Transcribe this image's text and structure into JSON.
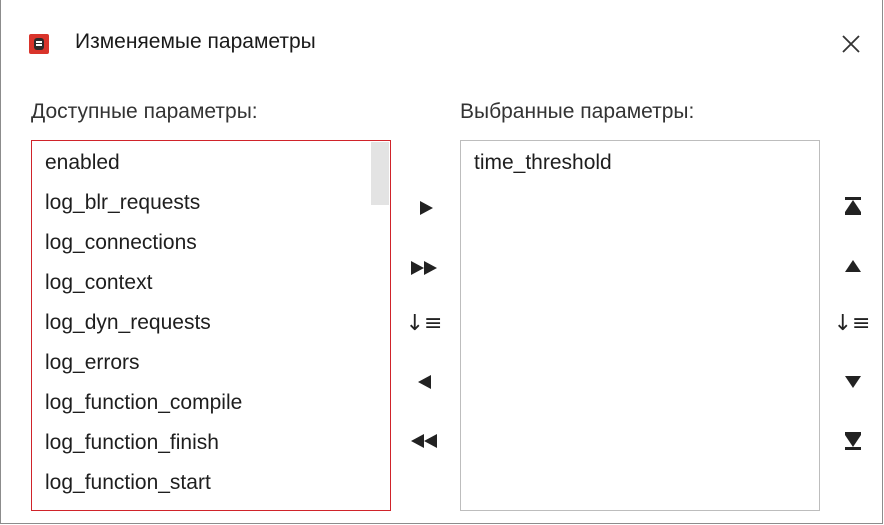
{
  "window": {
    "title": "Изменяемые параметры",
    "close_icon": "close-icon",
    "app_icon": "database-icon"
  },
  "available": {
    "label": "Доступные параметры:",
    "items": [
      "enabled",
      "log_blr_requests",
      "log_connections",
      "log_context",
      "log_dyn_requests",
      "log_errors",
      "log_function_compile",
      "log_function_finish",
      "log_function_start"
    ]
  },
  "selected": {
    "label": "Выбранные параметры:",
    "items": [
      "time_threshold"
    ]
  },
  "transfer_buttons": {
    "icons": [
      "move-right-icon",
      "move-all-right-icon",
      "sort-icon",
      "move-left-icon",
      "move-all-left-icon"
    ]
  },
  "order_buttons": {
    "icons": [
      "move-to-top-icon",
      "move-up-icon",
      "sort-icon",
      "move-down-icon",
      "move-to-bottom-icon"
    ],
    "sort_glyph": "↓≡"
  },
  "colors": {
    "accent_border": "#d0232a",
    "app_icon": "#d9342b"
  }
}
